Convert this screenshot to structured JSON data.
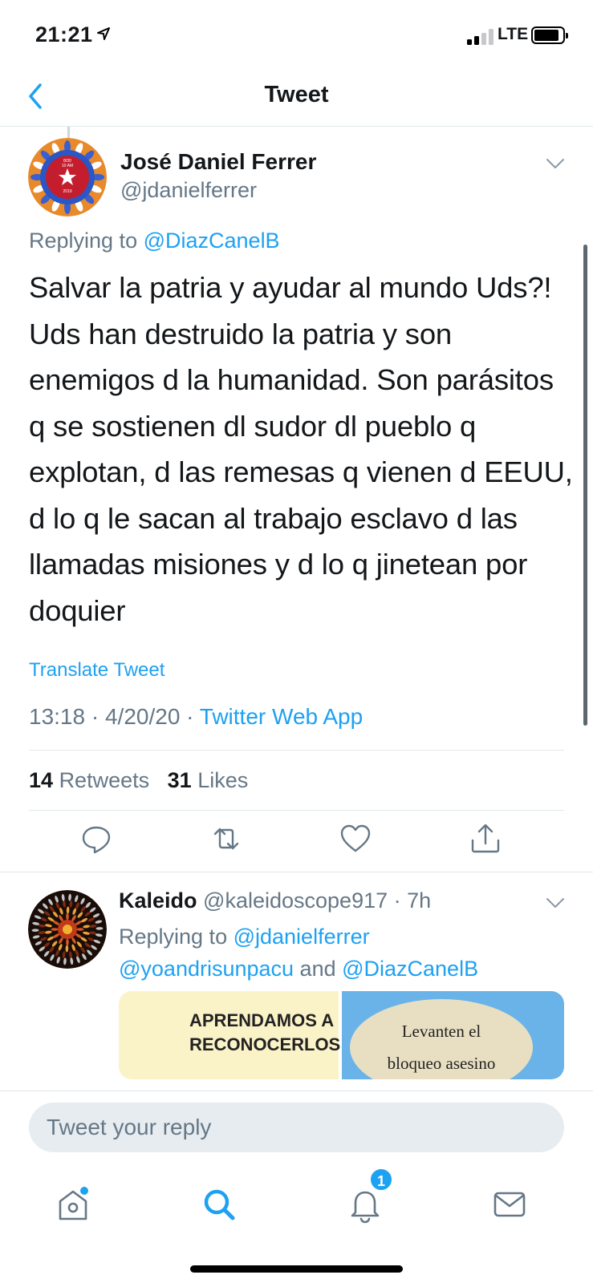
{
  "status": {
    "time": "21:21",
    "carrier": "LTE"
  },
  "nav": {
    "title": "Tweet"
  },
  "tweet": {
    "author_name": "José Daniel Ferrer",
    "author_handle": "@jdanielferrer",
    "replying_prefix": "Replying to ",
    "replying_to": "@DiazCanelB",
    "text": "Salvar la patria y ayudar al mundo Uds?! Uds han destruido la patria y son enemigos d la humanidad. Son parásitos q se sostienen dl sudor dl pueblo q explotan, d las remesas q vienen d EEUU, d lo q le sacan al trabajo esclavo d las llamadas misiones y d lo q jinetean por doquier",
    "translate_label": "Translate Tweet",
    "time": "13:18",
    "date": "4/20/20",
    "source": "Twitter Web App",
    "retweets_count": "14",
    "retweets_label": "Retweets",
    "likes_count": "31",
    "likes_label": "Likes",
    "avatar_lines": [
      "8/30",
      "10 AM",
      "2019"
    ]
  },
  "reply": {
    "author_name": "Kaleido",
    "author_handle": "@kaleidoscope917",
    "age": "7h",
    "replying_prefix": "Replying to ",
    "replying_to_1": "@jdanielferrer",
    "replying_to_2": "@yoandrisunpacu",
    "replying_and": " and ",
    "replying_to_3": "@DiazCanelB",
    "media_left_line1": "APRENDAMOS A",
    "media_left_line2": "RECONOCERLOS",
    "media_right_line1": "Levanten el",
    "media_right_line2": "bloqueo asesino"
  },
  "compose": {
    "placeholder": "Tweet your reply"
  },
  "tabbar": {
    "notifications_badge": "1"
  },
  "colors": {
    "accent": "#1da1f2",
    "secondary_text": "#657786",
    "divider": "#e1e8ed"
  }
}
